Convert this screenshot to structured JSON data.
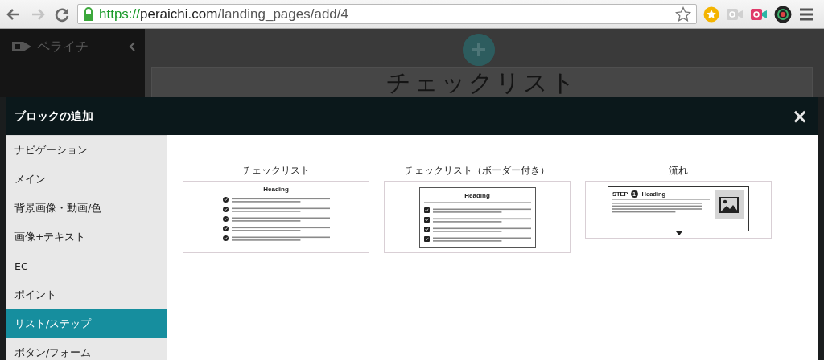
{
  "browser": {
    "back_disabled": false,
    "forward_disabled": true,
    "url_scheme": "https://",
    "url_host": "peraichi.com",
    "url_path": "/landing_pages/add/4"
  },
  "editor": {
    "logo": "ペライチ",
    "page_heading": "チェックリスト"
  },
  "modal": {
    "title": "ブロックの追加",
    "close": "×"
  },
  "categories": [
    {
      "label": "ナビゲーション",
      "selected": false
    },
    {
      "label": "メイン",
      "selected": false
    },
    {
      "label": "背景画像・動画/色",
      "selected": false
    },
    {
      "label": "画像+テキスト",
      "selected": false
    },
    {
      "label": "EC",
      "selected": false
    },
    {
      "label": "ポイント",
      "selected": false
    },
    {
      "label": "リスト/ステップ",
      "selected": true
    },
    {
      "label": "ボタン/フォーム",
      "selected": false
    }
  ],
  "blocks": [
    {
      "title": "チェックリスト",
      "kind": "checklist",
      "heading": "Heading"
    },
    {
      "title": "チェックリスト（ボーダー付き）",
      "kind": "checklist_bordered",
      "heading": "Heading"
    },
    {
      "title": "流れ",
      "kind": "flow",
      "step_label": "STEP",
      "step_number": "1",
      "heading": "Heading"
    }
  ]
}
